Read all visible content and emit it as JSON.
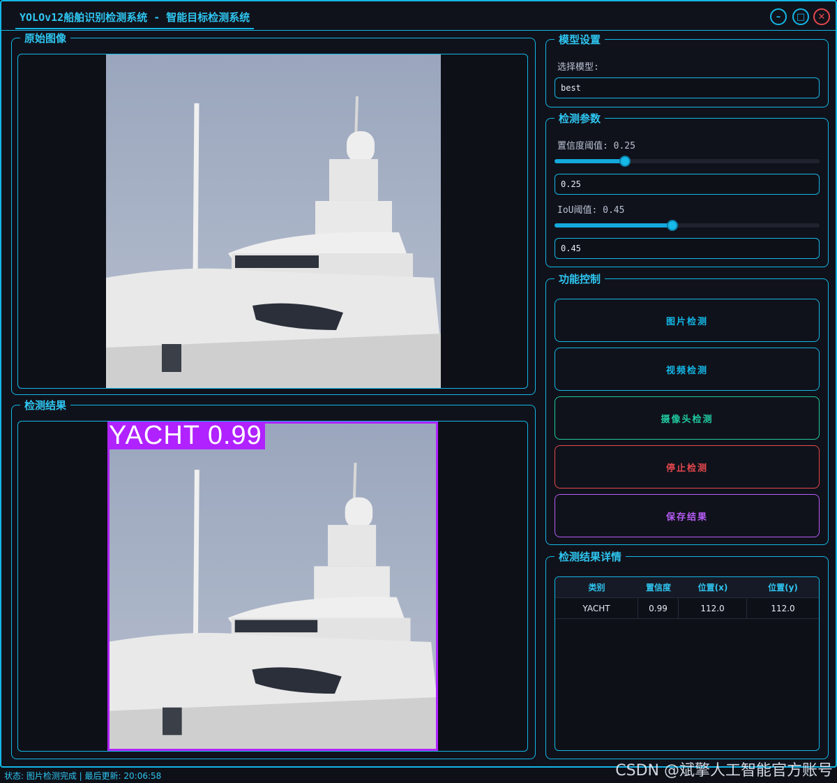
{
  "window": {
    "title": "YOLOv12船舶识别检测系统 - 智能目标检测系统",
    "minimize_icon": "minimize-icon",
    "maximize_icon": "maximize-icon",
    "close_icon": "close-icon"
  },
  "original_panel": {
    "title": "原始图像"
  },
  "result_panel": {
    "title": "检测结果",
    "detection_label": "YACHT 0.99",
    "box_color": "#b022ff"
  },
  "model_settings": {
    "title": "模型设置",
    "select_label": "选择模型:",
    "selected_model": "best"
  },
  "detection_params": {
    "title": "检测参数",
    "confidence_label": "置信度阈值: 0.25",
    "confidence_value": "0.25",
    "confidence_level": 0.25,
    "iou_label": "IoU阈值: 0.45",
    "iou_value": "0.45",
    "iou_level": 0.45
  },
  "function_control": {
    "title": "功能控制",
    "buttons": [
      {
        "label": "图片检测",
        "color": "#13b7e6"
      },
      {
        "label": "视频检测",
        "color": "#13b7e6"
      },
      {
        "label": "摄像头检测",
        "color": "#1fc9a0"
      },
      {
        "label": "停止检测",
        "color": "#e5484d"
      },
      {
        "label": "保存结果",
        "color": "#b65cf5"
      }
    ]
  },
  "results_detail": {
    "title": "检测结果详情",
    "columns": [
      "类别",
      "置信度",
      "位置(x)",
      "位置(y)"
    ],
    "rows": [
      [
        "YACHT",
        "0.99",
        "112.0",
        "112.0"
      ]
    ]
  },
  "status_bar": {
    "text": "状态: 图片检测完成 | 最后更新: 20:06:58"
  },
  "watermark": "CSDN @斌擎人工智能官方账号",
  "accent_color": "#13b7e6"
}
